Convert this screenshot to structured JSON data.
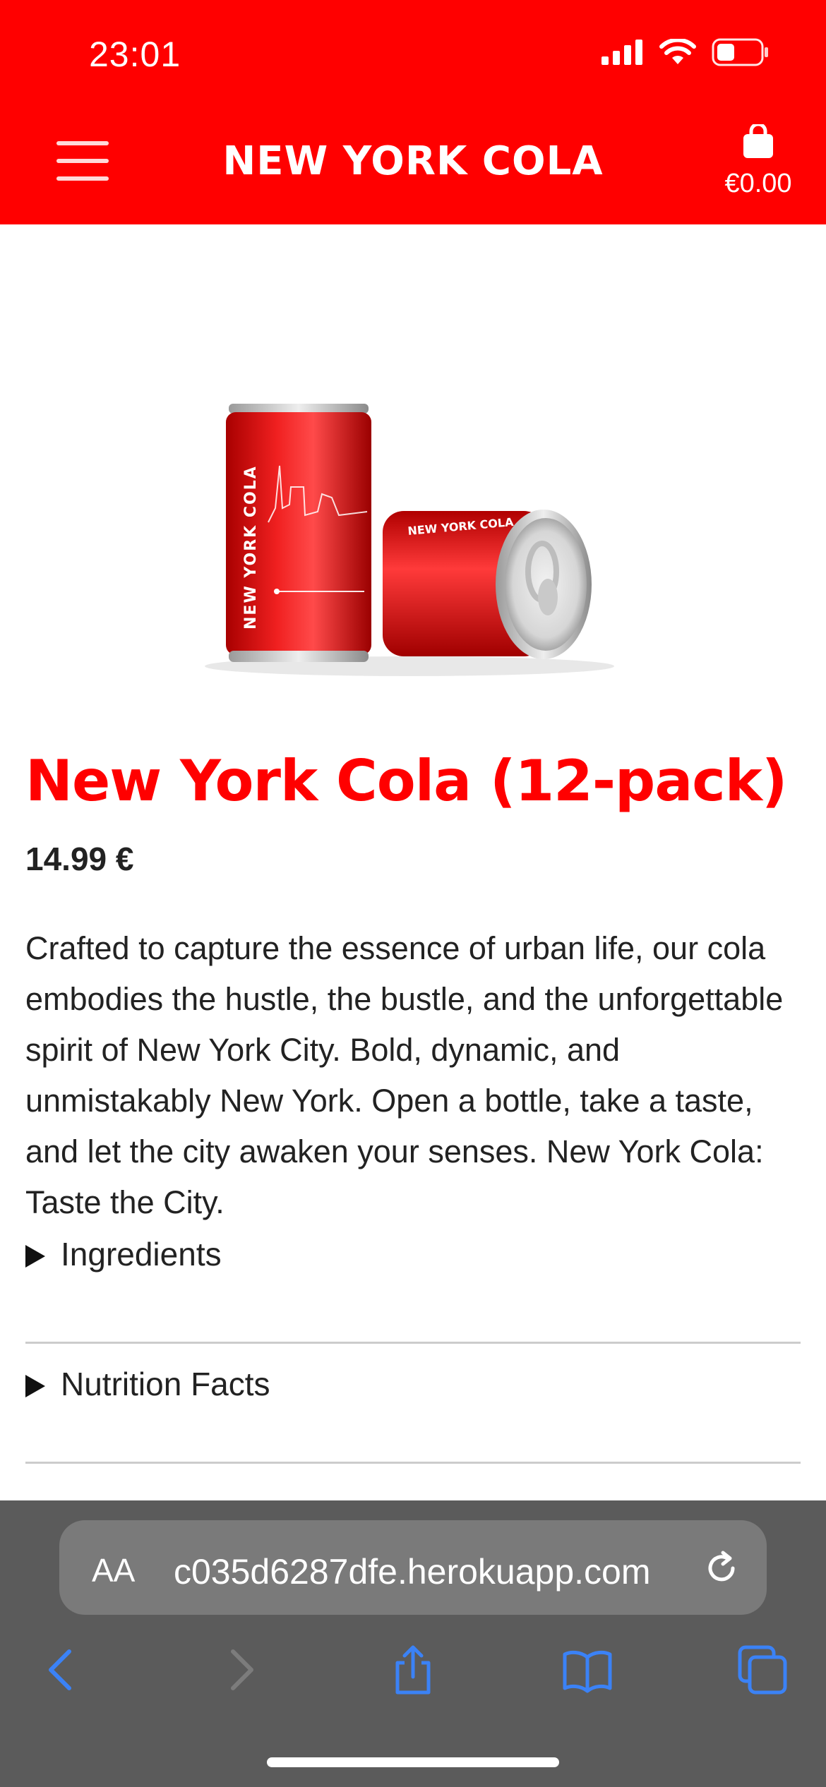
{
  "status_bar": {
    "time": "23:01"
  },
  "header": {
    "title": "NEW YORK COLA",
    "cart_total": "€0.00",
    "bg_color": "#ff0000"
  },
  "product": {
    "title": "New York Cola (12-pack)",
    "price": "14.99 €",
    "description": "Crafted to capture the essence of urban life, our cola embodies the hustle, the bustle, and the unforgettable spirit of New York City. Bold, dynamic, and unmistakably New York. Open a bottle, take a taste, and let the city awaken your senses. New York Cola: Taste the City.",
    "image": {
      "can_upright_label": "NEW YORK COLA",
      "can_side_label": "NEW YORK COLA"
    },
    "sections": [
      {
        "label": "Ingredients"
      },
      {
        "label": "Nutrition Facts"
      }
    ]
  },
  "browser": {
    "aa_label": "AA",
    "url": "c035d6287dfe.herokuapp.com",
    "icons": [
      "back-icon",
      "forward-icon",
      "share-icon",
      "bookmarks-icon",
      "tabs-icon"
    ]
  },
  "colors": {
    "accent": "#ff0000",
    "browser_bar": "#5b5b5b",
    "toolbar_icons": "#3b82f6"
  }
}
